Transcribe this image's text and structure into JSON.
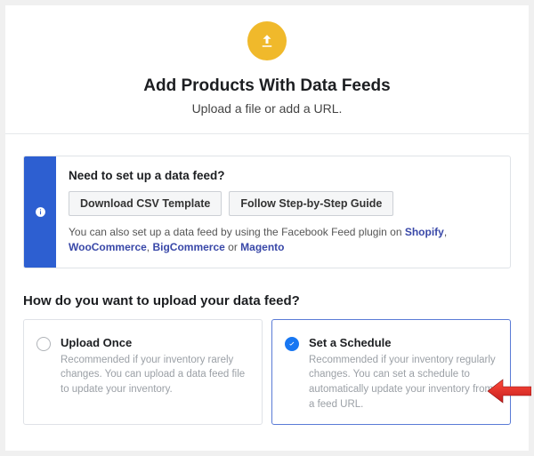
{
  "hero": {
    "title": "Add Products With Data Feeds",
    "subtitle": "Upload a file or add a URL."
  },
  "info": {
    "title": "Need to set up a data feed?",
    "btn_download": "Download CSV Template",
    "btn_guide": "Follow Step-by-Step Guide",
    "text_pre": "You can also set up a data feed by using the Facebook Feed plugin on ",
    "link_shopify": "Shopify",
    "link_woo": "WooCommerce",
    "link_big": "BigCommerce",
    "link_magento": "Magento"
  },
  "question": "How do you want to upload your data feed?",
  "options": {
    "once": {
      "title": "Upload Once",
      "desc": "Recommended if your inventory rarely changes. You can upload a data feed file to update your inventory."
    },
    "schedule": {
      "title": "Set a Schedule",
      "desc": "Recommended if your inventory regularly changes. You can set a schedule to automatically update your inventory from a feed URL."
    }
  }
}
